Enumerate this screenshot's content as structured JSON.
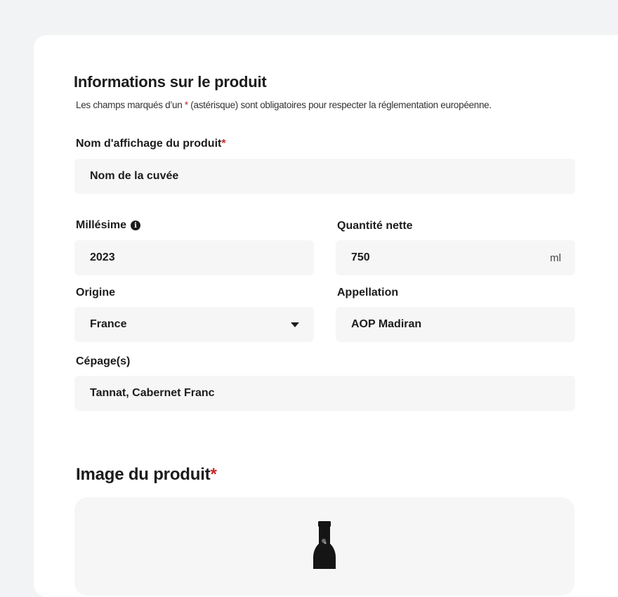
{
  "product_info": {
    "title": "Informations sur le produit",
    "subtitle_before": "Les champs marqués d’un ",
    "subtitle_star": "*",
    "subtitle_after": " (astérisque) sont obligatoires pour respecter la réglementation européenne."
  },
  "fields": {
    "display_name": {
      "label": "Nom d'affichage du produit",
      "required_mark": "*",
      "value": "Nom de la cuvée"
    },
    "vintage": {
      "label": "Millésime",
      "info_icon": "info-icon",
      "value": "2023"
    },
    "net_quantity": {
      "label": "Quantité nette",
      "value": "750",
      "unit": "ml"
    },
    "origin": {
      "label": "Origine",
      "value": "France",
      "icon": "caret-down-icon"
    },
    "appellation": {
      "label": "Appellation",
      "value": "AOP Madiran"
    },
    "grapes": {
      "label": "Cépage(s)",
      "value": "Tannat, Cabernet Franc"
    }
  },
  "product_image": {
    "title": "Image du produit",
    "required_mark": "*"
  },
  "colors": {
    "page_background": "#f2f3f5",
    "card_background": "#ffffff",
    "field_background": "#f6f6f6",
    "required": "#c62828",
    "text": "#1c1c1c"
  }
}
